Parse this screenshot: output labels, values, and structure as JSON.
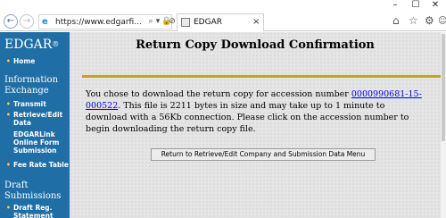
{
  "window": {
    "minimize_glyph": "–",
    "maximize_glyph": "☐",
    "close_glyph": "✕"
  },
  "browser": {
    "back_glyph": "←",
    "forward_glyph": "→",
    "url": "https://www.edgarfi...",
    "tab_title": "EDGAR",
    "tab_close_glyph": "×",
    "icons": [
      "home-icon",
      "star-icon",
      "gear-icon",
      "smiley-icon",
      "lock-icon",
      "refresh-icon",
      "search-icon"
    ]
  },
  "sidebar": {
    "logo": "EDGAR",
    "logo_mark": "®",
    "home": "Home",
    "section_information": "Information Exchange",
    "items": [
      {
        "label": "Transmit"
      },
      {
        "label": "Retrieve/Edit Data"
      },
      {
        "label": "EDGARLink Online Form Submission"
      },
      {
        "label": "Fee Rate Table"
      }
    ],
    "section_draft": "Draft Submissions",
    "draft_items": [
      {
        "label": "Draft Reg. Statement"
      }
    ]
  },
  "main": {
    "title": "Return Copy Download Confirmation",
    "text_before_link": "You chose to download the return copy for accession number ",
    "accession_number": "0000990681-15-000522",
    "text_after_link": ". This file is 2211 bytes in size and may take up to 1 minute to download with a 56Kb connection. Please click on the accession number to begin downloading the return copy file.",
    "return_button_label": "Return to Retrieve/Edit Company and Submission Data Menu"
  },
  "colors": {
    "sidebar_bg": "#1f6ea6",
    "accent_rule": "#c8a022",
    "link": "#0000ee"
  }
}
